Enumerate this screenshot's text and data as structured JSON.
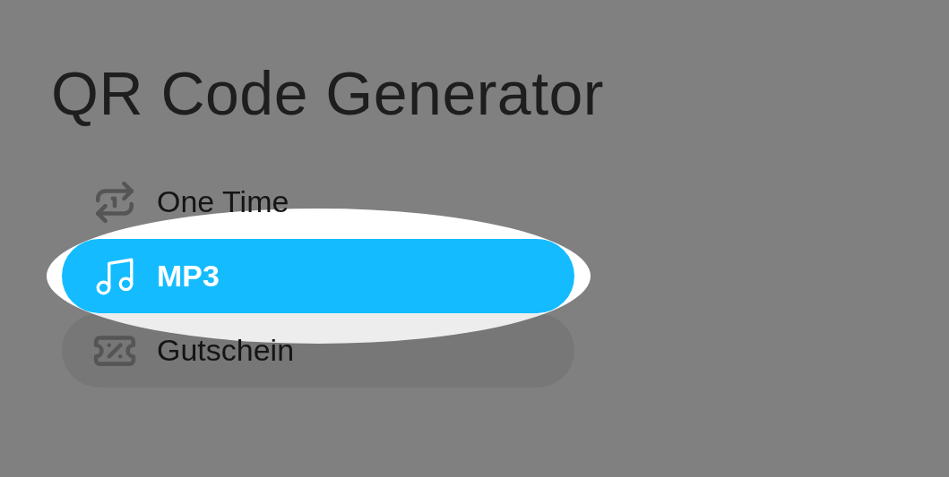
{
  "title": "QR Code Generator",
  "menu": [
    {
      "kind": "repeat-one",
      "label": "One Time",
      "selected": false,
      "hovered": false,
      "spotlight": false
    },
    {
      "kind": "music",
      "label": "MP3",
      "selected": true,
      "hovered": false,
      "spotlight": true
    },
    {
      "kind": "coupon",
      "label": "Gutschein",
      "selected": false,
      "hovered": true,
      "spotlight": false
    }
  ]
}
